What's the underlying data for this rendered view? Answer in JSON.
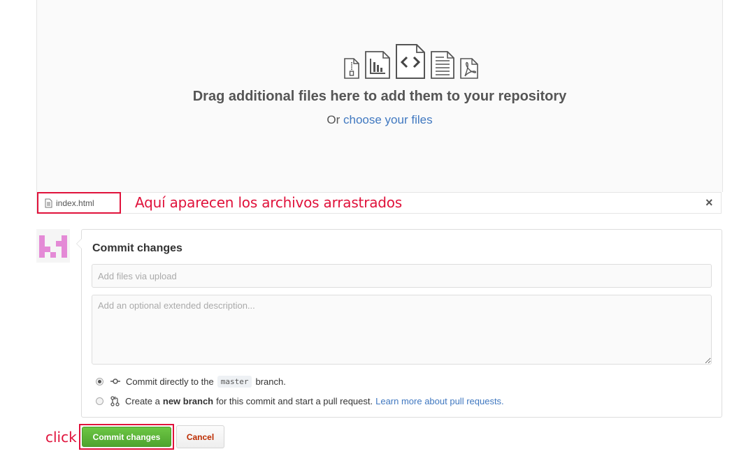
{
  "dropzone": {
    "title": "Drag additional files here to add them to your repository",
    "or_text": "Or",
    "choose_link": "choose your files",
    "icons": [
      "zip-file-icon",
      "chart-file-icon",
      "code-file-icon",
      "text-file-icon",
      "pdf-file-icon"
    ]
  },
  "file_row": {
    "file_name": "index.html",
    "annotation": "Aquí aparecen los archivos arrastrados",
    "remove_label": "×"
  },
  "commit": {
    "title": "Commit changes",
    "summary_placeholder": "Add files via upload",
    "description_placeholder": "Add an optional extended description...",
    "option_direct": {
      "prefix": "Commit directly to the",
      "branch": "master",
      "suffix": "branch."
    },
    "option_new_branch": {
      "prefix": "Create a",
      "bold": "new branch",
      "suffix": "for this commit and start a pull request.",
      "link": "Learn more about pull requests."
    },
    "selected_option": "direct"
  },
  "actions": {
    "click_annotation": "click",
    "commit_button": "Commit changes",
    "cancel_button": "Cancel"
  },
  "colors": {
    "annotation_red": "#e0123b",
    "link_blue": "#4078c0",
    "commit_green": "#6cc644",
    "avatar_pink": "#e48ad6"
  }
}
